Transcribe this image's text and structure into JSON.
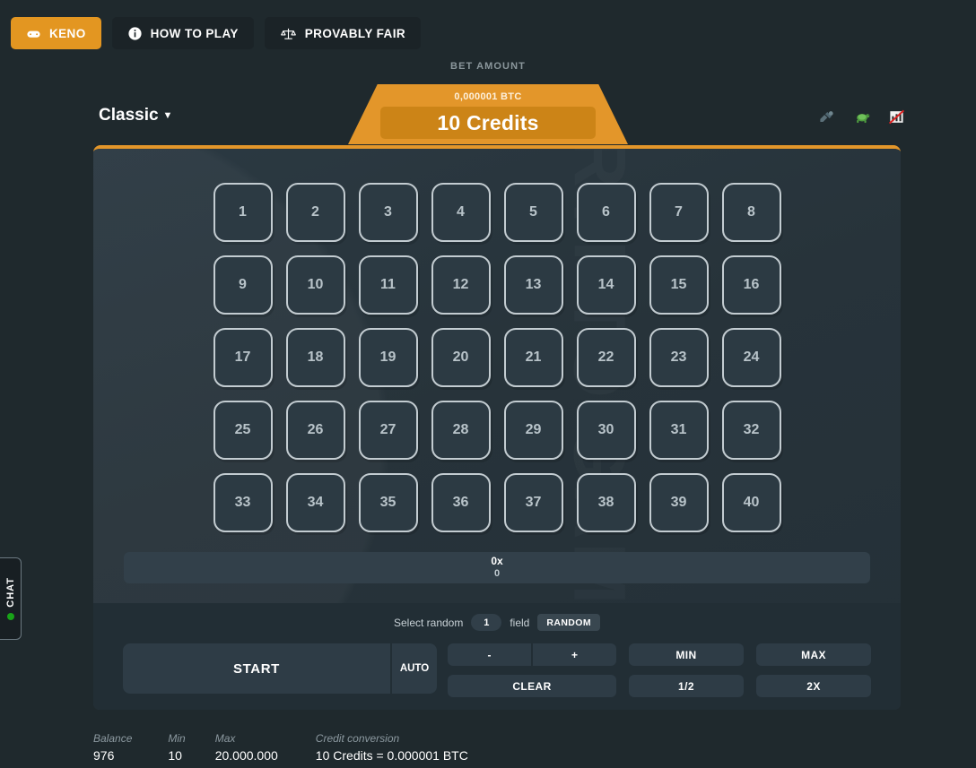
{
  "topbar": {
    "tabs": [
      {
        "label": "KENO",
        "icon": "gamepad-icon",
        "active": true
      },
      {
        "label": "HOW TO PLAY",
        "icon": "info-icon",
        "active": false
      },
      {
        "label": "PROVABLY FAIR",
        "icon": "scales-icon",
        "active": false
      }
    ]
  },
  "bet": {
    "label": "BET AMOUNT",
    "btc": "0,000001 BTC",
    "credits": "10 Credits"
  },
  "header": {
    "mode": "Classic",
    "caret": "▼",
    "icons": [
      {
        "name": "hotkeys-icon"
      },
      {
        "name": "turtle-speed-icon"
      },
      {
        "name": "stats-disabled-icon"
      }
    ]
  },
  "watermark": "CRYPTO GAMES",
  "grid": {
    "numbers": [
      1,
      2,
      3,
      4,
      5,
      6,
      7,
      8,
      9,
      10,
      11,
      12,
      13,
      14,
      15,
      16,
      17,
      18,
      19,
      20,
      21,
      22,
      23,
      24,
      25,
      26,
      27,
      28,
      29,
      30,
      31,
      32,
      33,
      34,
      35,
      36,
      37,
      38,
      39,
      40
    ]
  },
  "multiplier": {
    "x": "0x",
    "value": "0"
  },
  "random_row": {
    "prefix": "Select random",
    "count": "1",
    "suffix": "field",
    "button": "RANDOM"
  },
  "buttons": {
    "start": "START",
    "auto": "AUTO",
    "minus": "-",
    "plus": "+",
    "min": "MIN",
    "max": "MAX",
    "clear": "CLEAR",
    "half": "1/2",
    "double": "2X"
  },
  "footer": {
    "items": [
      {
        "label": "Balance",
        "value": "976"
      },
      {
        "label": "Min",
        "value": "10"
      },
      {
        "label": "Max",
        "value": "20.000.000"
      },
      {
        "label": "Credit conversion",
        "value": "10 Credits = 0.000001 BTC"
      }
    ]
  },
  "chat": {
    "label": "CHAT"
  },
  "colors": {
    "accent": "#e3962a",
    "page_bg": "#1f292d",
    "panel_bg": "#27333a",
    "online_dot": "#18a318"
  }
}
